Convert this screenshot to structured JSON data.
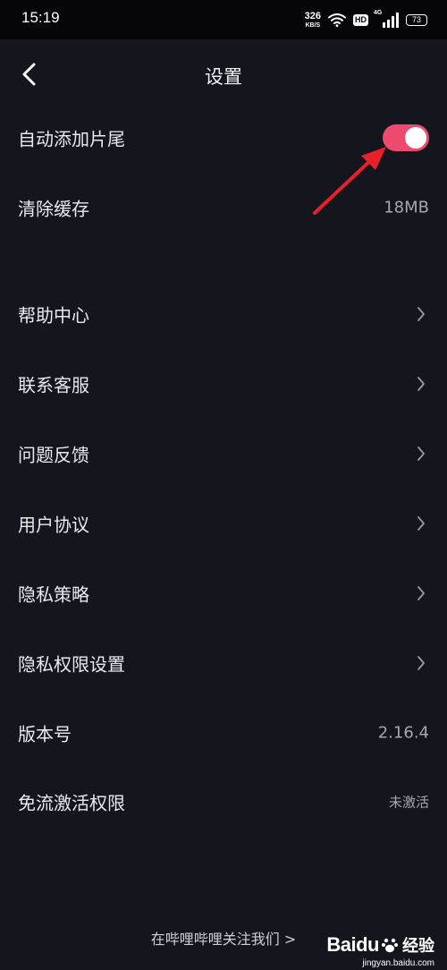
{
  "status_bar": {
    "time": "15:19",
    "net_speed_value": "326",
    "net_speed_unit": "KB/S",
    "hd_label": "HD",
    "signal_label": "4G",
    "battery": "73"
  },
  "header": {
    "title": "设置",
    "back_icon": "chevron-left-icon"
  },
  "settings": {
    "auto_end_card": {
      "label": "自动添加片尾",
      "enabled": true,
      "toggle_color": "#ec4a6e"
    },
    "clear_cache": {
      "label": "清除缓存",
      "value": "18MB"
    },
    "help_center": {
      "label": "帮助中心"
    },
    "contact_support": {
      "label": "联系客服"
    },
    "feedback": {
      "label": "问题反馈"
    },
    "user_agreement": {
      "label": "用户协议"
    },
    "privacy_policy": {
      "label": "隐私策略"
    },
    "privacy_permissions": {
      "label": "隐私权限设置"
    },
    "version": {
      "label": "版本号",
      "value": "2.16.4"
    },
    "free_data": {
      "label": "免流激活权限",
      "value": "未激活"
    }
  },
  "footer": {
    "follow_link": "在哔哩哔哩关注我们 >"
  },
  "watermark": {
    "brand": "Baidu",
    "cn": "经验",
    "url": "jingyan.baidu.com"
  },
  "colors": {
    "background": "#15151d",
    "accent": "#ec4a6e",
    "annotation": "#e8202a"
  }
}
